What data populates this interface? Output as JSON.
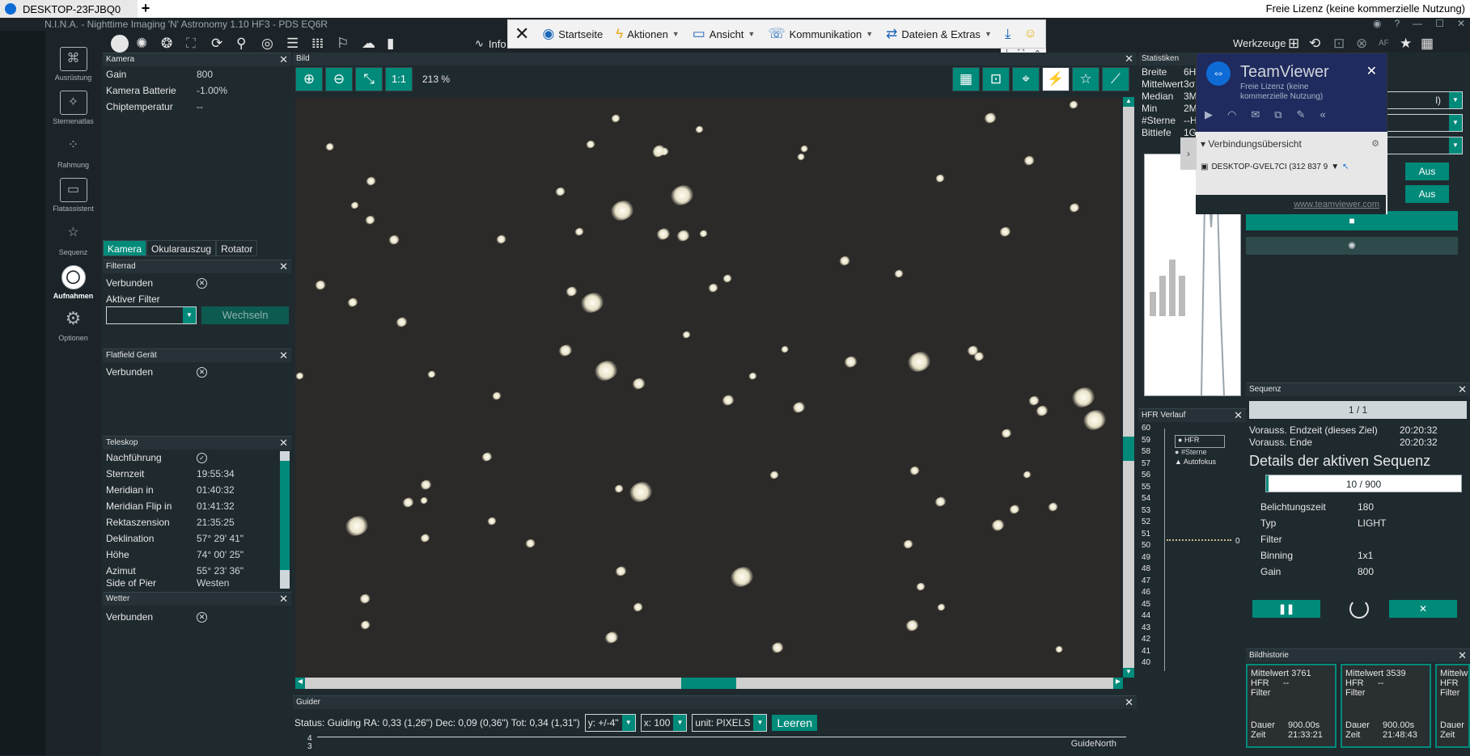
{
  "tv_tabs": {
    "tab_title": "DESKTOP-23FJBQ0",
    "plus": "+",
    "license": "Freie Lizenz (keine kommerzielle Nutzung)"
  },
  "titlebar": {
    "title": "N.I.N.A. - Nighttime Imaging 'N' Astronomy 1.10 HF3  -  PDS EQ6R"
  },
  "toolbar": {
    "info_label": "Info",
    "werkzeuge_label": "Werkzeuge"
  },
  "tv_bar": {
    "items": [
      {
        "label": "Startseite",
        "icon": "tv-home-icon"
      },
      {
        "label": "Aktionen",
        "icon": "lightning-icon"
      },
      {
        "label": "Ansicht",
        "icon": "monitor-icon"
      },
      {
        "label": "Kommunikation",
        "icon": "phone-icon"
      },
      {
        "label": "Dateien & Extras",
        "icon": "file-transfer-icon"
      }
    ]
  },
  "leftnav": [
    {
      "label": "Ausrüstung",
      "glyph": "⌘"
    },
    {
      "label": "Sternenatlas",
      "glyph": "✧"
    },
    {
      "label": "Rahmung",
      "glyph": "⁘"
    },
    {
      "label": "Flatassistent",
      "glyph": "▭"
    },
    {
      "label": "Sequenz",
      "glyph": "☆"
    },
    {
      "label": "Aufnahmen",
      "glyph": "◯"
    },
    {
      "label": "Optionen",
      "glyph": "⚙"
    }
  ],
  "camera": {
    "title": "Kamera",
    "rows": [
      {
        "label": "Gain",
        "value": "800"
      },
      {
        "label": "Kamera Batterie",
        "value": "-1.00%"
      },
      {
        "label": "Chiptemperatur",
        "value": "--"
      }
    ]
  },
  "camera_tabs": [
    "Kamera",
    "Okularauszug",
    "Rotator"
  ],
  "filterwheel": {
    "title": "Filterrad",
    "connected": "Verbunden",
    "active_filter": "Aktiver Filter",
    "change_button": "Wechseln"
  },
  "flatfield": {
    "title": "Flatfield Gerät",
    "connected": "Verbunden"
  },
  "telescope": {
    "title": "Teleskop",
    "rows": [
      {
        "label": "Nachführung",
        "value": ""
      },
      {
        "label": "Sternzeit",
        "value": "19:55:34"
      },
      {
        "label": "Meridian in",
        "value": "01:40:32"
      },
      {
        "label": "Meridian Flip in",
        "value": "01:41:32"
      },
      {
        "label": "Rektaszension",
        "value": "21:35:25"
      },
      {
        "label": "Deklination",
        "value": "57° 29' 41\""
      },
      {
        "label": "Höhe",
        "value": "74° 00' 25\""
      },
      {
        "label": "Azimut",
        "value": "55° 23' 36\""
      },
      {
        "label": "Side of Pier",
        "value": "Westen"
      }
    ]
  },
  "weather": {
    "title": "Wetter",
    "connected": "Verbunden"
  },
  "image": {
    "title": "Bild",
    "zoom": "213 %",
    "one_to_one": "1:1"
  },
  "stats": {
    "title": "Statistiken",
    "rows": [
      {
        "label": "Breite",
        "value": "6H"
      },
      {
        "label": "Mittelwert",
        "value": "3σ"
      },
      {
        "label": "Median",
        "value": "3M"
      },
      {
        "label": "Min",
        "value": "2M"
      },
      {
        "label": "#Sterne",
        "value": "--H"
      },
      {
        "label": "Bittiefe",
        "value": "1G"
      }
    ]
  },
  "hfr": {
    "title": "HFR Verlauf",
    "ticks": [
      "60",
      "59",
      "58",
      "57",
      "56",
      "55",
      "54",
      "53",
      "52",
      "51",
      "50",
      "49",
      "48",
      "47",
      "46",
      "45",
      "44",
      "43",
      "42",
      "41",
      "40"
    ],
    "legend": [
      "HFR",
      "#Sterne",
      "Autofokus"
    ],
    "right_zero": "0"
  },
  "teamviewer": {
    "brand": "TeamViewer",
    "subtitle": "Freie Lizenz (keine kommerzielle Nutzung)",
    "connection_title": "Verbindungsübersicht",
    "device": "DESKTOP-GVEL7CI (312 837 9",
    "link": "www.teamviewer.com"
  },
  "right_panel": {
    "off1": "Aus",
    "off2": "Aus",
    "partial_text": "l)"
  },
  "sequence": {
    "title": "Sequenz",
    "progress_label": "1 / 1",
    "end_target_label": "Vorauss. Endzeit (dieses Ziel)",
    "end_target_value": "20:20:32",
    "end_label": "Vorauss. Ende",
    "end_value": "20:20:32",
    "details_title": "Details der aktiven Sequenz",
    "exposure_progress": "10 / 900",
    "exposure_fraction": 0.011,
    "rows": [
      {
        "label": "Belichtungszeit",
        "value": "180"
      },
      {
        "label": "Typ",
        "value": "LIGHT"
      },
      {
        "label": "Filter",
        "value": ""
      },
      {
        "label": "Binning",
        "value": "1x1"
      },
      {
        "label": "Gain",
        "value": "800"
      }
    ]
  },
  "history": {
    "title": "Bildhistorie",
    "items": [
      {
        "mean": "Mittelwert 3761",
        "hfr": "HFR",
        "hfr_v": "--",
        "filter": "Filter",
        "dur_l": "Dauer",
        "dur": "900.00s",
        "time_l": "Zeit",
        "time": "21:33:21"
      },
      {
        "mean": "Mittelwert 3539",
        "hfr": "HFR",
        "hfr_v": "--",
        "filter": "Filter",
        "dur_l": "Dauer",
        "dur": "900.00s",
        "time_l": "Zeit",
        "time": "21:48:43"
      },
      {
        "mean": "Mittelw",
        "hfr": "HFR",
        "hfr_v": "",
        "filter": "Filter",
        "dur_l": "Dauer",
        "dur": "",
        "time_l": "Zeit",
        "time": ""
      }
    ]
  },
  "guider": {
    "title": "Guider",
    "status": "Status: Guiding  RA: 0,33 (1,26\")  Dec: 0,09 (0,36\")  Tot: 0,34 (1,31\")",
    "y_select": "y: +/-4\"",
    "x_select": "x: 100",
    "unit_select": "unit: PIXELS",
    "clear_button": "Leeren",
    "axis_top": "4",
    "axis_next": "3",
    "series_label": "GuideNorth"
  }
}
